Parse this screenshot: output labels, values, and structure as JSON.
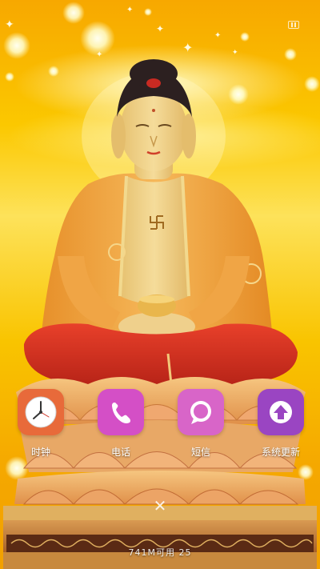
{
  "colors": {
    "clock_icon_bg": "#e86a3a",
    "phone_icon_bg": "#d44fc6",
    "sms_icon_bg": "#d865c8",
    "update_icon_bg": "#9a45c2",
    "label_text": "#ffffff"
  },
  "apps": [
    {
      "label": "时钟",
      "icon": "clock-icon"
    },
    {
      "label": "电话",
      "icon": "phone-icon"
    },
    {
      "label": "短信",
      "icon": "message-icon"
    },
    {
      "label": "系统更新",
      "icon": "upload-arrow-icon"
    }
  ],
  "memory": {
    "text": "741M可用 25"
  },
  "clean_button": {
    "icon": "close-icon"
  }
}
